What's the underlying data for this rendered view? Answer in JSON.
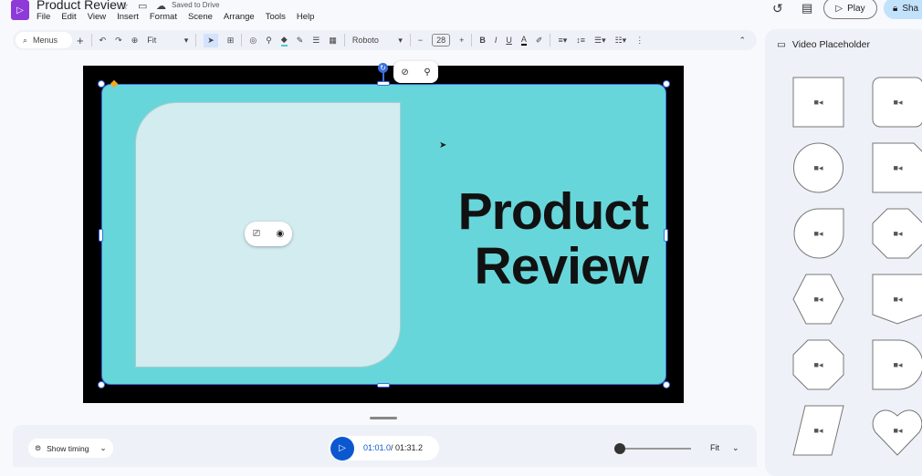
{
  "header": {
    "title": "Product Review",
    "saved_status": "Saved to Drive",
    "menu": [
      "File",
      "Edit",
      "View",
      "Insert",
      "Format",
      "Scene",
      "Arrange",
      "Tools",
      "Help"
    ],
    "play_label": "Play",
    "share_label": "Sha"
  },
  "toolbar": {
    "search_label": "Menus",
    "zoom": "Fit",
    "font": "Roboto",
    "font_size": "28"
  },
  "slide": {
    "title_line1": "Product",
    "title_line2": "Review",
    "accent": "#67d6da"
  },
  "bottom": {
    "show_timing": "Show timing",
    "current_time": "01:01.0",
    "total_time": "/ 01:31.2",
    "zoom": "Fit"
  },
  "panel": {
    "title": "Video Placeholder",
    "shapes": [
      "square",
      "rounded-square",
      "circle",
      "snipped-rect",
      "teardrop",
      "octagon",
      "hexagon",
      "pentagon-arrow",
      "octagon",
      "half-round",
      "parallelogram",
      "heart"
    ]
  }
}
